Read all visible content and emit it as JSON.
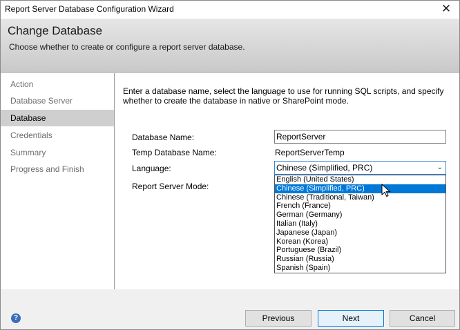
{
  "window": {
    "title": "Report Server Database Configuration Wizard",
    "close_glyph": "✕"
  },
  "header": {
    "title": "Change Database",
    "subtitle": "Choose whether to create or configure a report server database."
  },
  "sidebar": {
    "items": [
      {
        "label": "Action",
        "active": false
      },
      {
        "label": "Database Server",
        "active": false
      },
      {
        "label": "Database",
        "active": true
      },
      {
        "label": "Credentials",
        "active": false
      },
      {
        "label": "Summary",
        "active": false
      },
      {
        "label": "Progress and Finish",
        "active": false
      }
    ]
  },
  "main": {
    "intro": "Enter a database name, select the language to use for running SQL scripts, and specify whether to create the database in native or SharePoint mode.",
    "database_name": {
      "label": "Database Name:",
      "value": "ReportServer"
    },
    "temp_database_name": {
      "label": "Temp Database Name:",
      "value": "ReportServerTemp"
    },
    "language": {
      "label": "Language:",
      "selected": "Chinese (Simplified, PRC)",
      "options": [
        "English (United States)",
        "Chinese (Simplified, PRC)",
        "Chinese (Traditional, Taiwan)",
        "French (France)",
        "German (Germany)",
        "Italian (Italy)",
        "Japanese (Japan)",
        "Korean (Korea)",
        "Portuguese (Brazil)",
        "Russian (Russia)",
        "Spanish (Spain)"
      ],
      "highlighted_index": 1
    },
    "report_server_mode": {
      "label": "Report Server Mode:"
    }
  },
  "footer": {
    "help_glyph": "?",
    "previous_label": "Previous",
    "next_label": "Next",
    "cancel_label": "Cancel"
  },
  "icons": {
    "close": "close-icon",
    "chevron": "chevron-down-icon",
    "help": "help-icon",
    "cursor": "mouse-cursor-icon"
  },
  "colors": {
    "selection": "#0078d7",
    "focus_border": "#3a86d8",
    "help_icon": "#3a6fb8"
  }
}
